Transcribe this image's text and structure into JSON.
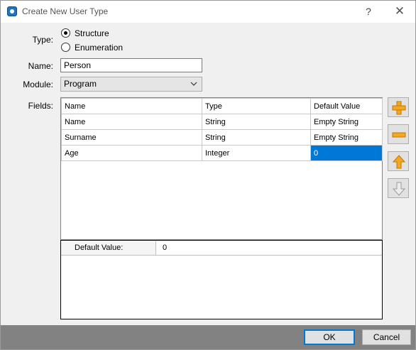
{
  "window": {
    "title": "Create New User Type",
    "help": "?",
    "close": "✕"
  },
  "form": {
    "type_label": "Type:",
    "type_options": [
      "Structure",
      "Enumeration"
    ],
    "type_selected": "Structure",
    "name_label": "Name:",
    "name_value": "Person",
    "module_label": "Module:",
    "module_value": "Program",
    "fields_label": "Fields:"
  },
  "fields_table": {
    "columns": [
      "Name",
      "Type",
      "Default Value"
    ],
    "rows": [
      [
        "Name",
        "String",
        "Empty String"
      ],
      [
        "Surname",
        "String",
        "Empty String"
      ],
      [
        "Age",
        "Integer",
        "0"
      ]
    ],
    "selected_cell": "Age.Default Value"
  },
  "property_panel": {
    "name": "Default Value:",
    "value": "0"
  },
  "side_buttons": {
    "add": "plus-icon",
    "remove": "minus-icon",
    "move_up": "arrow-up-icon",
    "move_down": "arrow-down-icon"
  },
  "footer": {
    "ok": "OK",
    "cancel": "Cancel"
  },
  "colors": {
    "accent": "#0078d7",
    "icon_orange": "#f5a623",
    "icon_disabled": "#b0b0b0",
    "footer_bg": "#828282"
  }
}
